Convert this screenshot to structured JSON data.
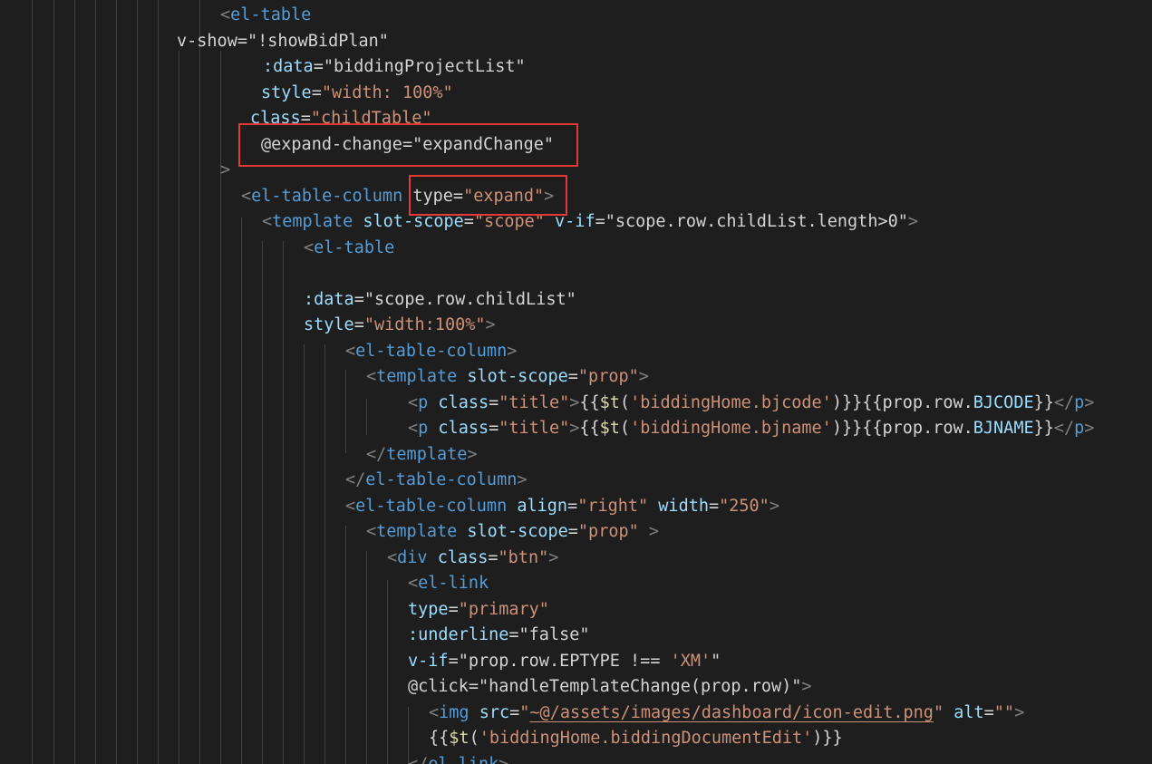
{
  "colors": {
    "background": "#1e1e1e",
    "indent_guide": "#404040",
    "punctuation": "#808080",
    "tag": "#569cd6",
    "attribute": "#9cdcfe",
    "string": "#ce9178",
    "plain": "#d4d4d4",
    "function": "#dcdcaa",
    "highlight_border": "#e53935"
  },
  "lines": [
    {
      "indent": 243,
      "tokens": [
        {
          "t": "<",
          "c": "punct"
        },
        {
          "t": "el-table",
          "c": "tag"
        }
      ]
    },
    {
      "indent": 195,
      "tokens": [
        {
          "t": "v-show=",
          "c": "plain"
        },
        {
          "t": "\"!showBidPlan\"",
          "c": "plain"
        }
      ]
    },
    {
      "indent": 290,
      "tokens": [
        {
          "t": ":data",
          "c": "attr"
        },
        {
          "t": "=",
          "c": "plain"
        },
        {
          "t": "\"biddingProjectList\"",
          "c": "plain"
        }
      ]
    },
    {
      "indent": 288,
      "tokens": [
        {
          "t": "style",
          "c": "attr"
        },
        {
          "t": "=",
          "c": "plain"
        },
        {
          "t": "\"width: 100%\"",
          "c": "str"
        }
      ]
    },
    {
      "indent": 276,
      "tokens": [
        {
          "t": "class",
          "c": "attr"
        },
        {
          "t": "=",
          "c": "plain"
        },
        {
          "t": "\"childTable\"",
          "c": "str"
        }
      ]
    },
    {
      "indent": 288,
      "tokens": [
        {
          "t": "@expand-change",
          "c": "plain"
        },
        {
          "t": "=",
          "c": "plain"
        },
        {
          "t": "\"expandChange\"",
          "c": "plain"
        }
      ]
    },
    {
      "indent": 243,
      "tokens": [
        {
          "t": ">",
          "c": "punct"
        }
      ]
    },
    {
      "indent": 266,
      "tokens": [
        {
          "t": "<",
          "c": "punct"
        },
        {
          "t": "el-table-column",
          "c": "tag"
        },
        {
          "t": " ",
          "c": "plain"
        },
        {
          "t": "type",
          "c": "plain"
        },
        {
          "t": "=",
          "c": "plain"
        },
        {
          "t": "\"expand\"",
          "c": "str"
        },
        {
          "t": ">",
          "c": "punct"
        }
      ]
    },
    {
      "indent": 289,
      "tokens": [
        {
          "t": "<",
          "c": "punct"
        },
        {
          "t": "template",
          "c": "tag"
        },
        {
          "t": " slot-scope",
          "c": "attr"
        },
        {
          "t": "=",
          "c": "plain"
        },
        {
          "t": "\"scope\"",
          "c": "str"
        },
        {
          "t": " v-if",
          "c": "attr"
        },
        {
          "t": "=",
          "c": "plain"
        },
        {
          "t": "\"scope.row.childList.length>0\"",
          "c": "plain"
        },
        {
          "t": ">",
          "c": "punct"
        }
      ]
    },
    {
      "indent": 335,
      "tokens": [
        {
          "t": "<",
          "c": "punct"
        },
        {
          "t": "el-table",
          "c": "tag"
        }
      ]
    },
    {
      "indent": 335,
      "tokens": []
    },
    {
      "indent": 335,
      "tokens": [
        {
          "t": ":data",
          "c": "attr"
        },
        {
          "t": "=",
          "c": "plain"
        },
        {
          "t": "\"scope.row.childList\"",
          "c": "plain"
        }
      ]
    },
    {
      "indent": 335,
      "tokens": [
        {
          "t": "style",
          "c": "attr"
        },
        {
          "t": "=",
          "c": "plain"
        },
        {
          "t": "\"width:100%\"",
          "c": "str"
        },
        {
          "t": ">",
          "c": "punct"
        }
      ]
    },
    {
      "indent": 381,
      "tokens": [
        {
          "t": "<",
          "c": "punct"
        },
        {
          "t": "el-table-column",
          "c": "tag"
        },
        {
          "t": ">",
          "c": "punct"
        }
      ]
    },
    {
      "indent": 404,
      "tokens": [
        {
          "t": "<",
          "c": "punct"
        },
        {
          "t": "template",
          "c": "tag"
        },
        {
          "t": " slot-scope",
          "c": "attr"
        },
        {
          "t": "=",
          "c": "plain"
        },
        {
          "t": "\"prop\"",
          "c": "str"
        },
        {
          "t": ">",
          "c": "punct"
        }
      ]
    },
    {
      "indent": 450,
      "tokens": [
        {
          "t": "<",
          "c": "punct"
        },
        {
          "t": "p",
          "c": "tag"
        },
        {
          "t": " class",
          "c": "attr"
        },
        {
          "t": "=",
          "c": "plain"
        },
        {
          "t": "\"title\"",
          "c": "str"
        },
        {
          "t": ">",
          "c": "punct"
        },
        {
          "t": "{{",
          "c": "plain"
        },
        {
          "t": "$t",
          "c": "fn"
        },
        {
          "t": "(",
          "c": "plain"
        },
        {
          "t": "'biddingHome.bjcode'",
          "c": "str"
        },
        {
          "t": ")}}{{prop.row.",
          "c": "plain"
        },
        {
          "t": "BJCODE",
          "c": "attr"
        },
        {
          "t": "}}",
          "c": "plain"
        },
        {
          "t": "</",
          "c": "punct"
        },
        {
          "t": "p",
          "c": "tag"
        },
        {
          "t": ">",
          "c": "punct"
        }
      ]
    },
    {
      "indent": 450,
      "tokens": [
        {
          "t": "<",
          "c": "punct"
        },
        {
          "t": "p",
          "c": "tag"
        },
        {
          "t": " class",
          "c": "attr"
        },
        {
          "t": "=",
          "c": "plain"
        },
        {
          "t": "\"title\"",
          "c": "str"
        },
        {
          "t": ">",
          "c": "punct"
        },
        {
          "t": "{{",
          "c": "plain"
        },
        {
          "t": "$t",
          "c": "fn"
        },
        {
          "t": "(",
          "c": "plain"
        },
        {
          "t": "'biddingHome.bjname'",
          "c": "str"
        },
        {
          "t": ")}}{{prop.row.",
          "c": "plain"
        },
        {
          "t": "BJNAME",
          "c": "attr"
        },
        {
          "t": "}}",
          "c": "plain"
        },
        {
          "t": "</",
          "c": "punct"
        },
        {
          "t": "p",
          "c": "tag"
        },
        {
          "t": ">",
          "c": "punct"
        }
      ]
    },
    {
      "indent": 404,
      "tokens": [
        {
          "t": "</",
          "c": "punct"
        },
        {
          "t": "template",
          "c": "tag"
        },
        {
          "t": ">",
          "c": "punct"
        }
      ]
    },
    {
      "indent": 381,
      "tokens": [
        {
          "t": "</",
          "c": "punct"
        },
        {
          "t": "el-table-column",
          "c": "tag"
        },
        {
          "t": ">",
          "c": "punct"
        }
      ]
    },
    {
      "indent": 381,
      "tokens": [
        {
          "t": "<",
          "c": "punct"
        },
        {
          "t": "el-table-column",
          "c": "tag"
        },
        {
          "t": " align",
          "c": "attr"
        },
        {
          "t": "=",
          "c": "plain"
        },
        {
          "t": "\"right\"",
          "c": "str"
        },
        {
          "t": " width",
          "c": "attr"
        },
        {
          "t": "=",
          "c": "plain"
        },
        {
          "t": "\"250\"",
          "c": "str"
        },
        {
          "t": ">",
          "c": "punct"
        }
      ]
    },
    {
      "indent": 404,
      "tokens": [
        {
          "t": "<",
          "c": "punct"
        },
        {
          "t": "template",
          "c": "tag"
        },
        {
          "t": " slot-scope",
          "c": "attr"
        },
        {
          "t": "=",
          "c": "plain"
        },
        {
          "t": "\"prop\"",
          "c": "str"
        },
        {
          "t": " >",
          "c": "punct"
        }
      ]
    },
    {
      "indent": 427,
      "tokens": [
        {
          "t": "<",
          "c": "punct"
        },
        {
          "t": "div",
          "c": "tag"
        },
        {
          "t": " class",
          "c": "attr"
        },
        {
          "t": "=",
          "c": "plain"
        },
        {
          "t": "\"btn\"",
          "c": "str"
        },
        {
          "t": ">",
          "c": "punct"
        }
      ]
    },
    {
      "indent": 450,
      "tokens": [
        {
          "t": "<",
          "c": "punct"
        },
        {
          "t": "el-link",
          "c": "tag"
        }
      ]
    },
    {
      "indent": 450,
      "tokens": [
        {
          "t": "type",
          "c": "attr"
        },
        {
          "t": "=",
          "c": "plain"
        },
        {
          "t": "\"primary\"",
          "c": "str"
        }
      ]
    },
    {
      "indent": 450,
      "tokens": [
        {
          "t": ":underline",
          "c": "attr"
        },
        {
          "t": "=",
          "c": "plain"
        },
        {
          "t": "\"false\"",
          "c": "plain"
        }
      ]
    },
    {
      "indent": 450,
      "tokens": [
        {
          "t": "v-if",
          "c": "attr"
        },
        {
          "t": "=",
          "c": "plain"
        },
        {
          "t": "\"prop.row.EPTYPE !== ",
          "c": "plain"
        },
        {
          "t": "'XM'",
          "c": "str"
        },
        {
          "t": "\"",
          "c": "plain"
        }
      ]
    },
    {
      "indent": 450,
      "tokens": [
        {
          "t": "@click",
          "c": "plain"
        },
        {
          "t": "=",
          "c": "plain"
        },
        {
          "t": "\"handleTemplateChange(prop.row)\"",
          "c": "plain"
        },
        {
          "t": ">",
          "c": "punct"
        }
      ]
    },
    {
      "indent": 473,
      "tokens": [
        {
          "t": "<",
          "c": "punct"
        },
        {
          "t": "img",
          "c": "tag"
        },
        {
          "t": " src",
          "c": "attr"
        },
        {
          "t": "=",
          "c": "plain"
        },
        {
          "t": "\"",
          "c": "str"
        },
        {
          "t": "~@/assets/images/dashboard/icon-edit.png",
          "c": "str ul"
        },
        {
          "t": "\"",
          "c": "str"
        },
        {
          "t": " alt",
          "c": "attr"
        },
        {
          "t": "=",
          "c": "plain"
        },
        {
          "t": "\"\"",
          "c": "str"
        },
        {
          "t": ">",
          "c": "punct"
        }
      ]
    },
    {
      "indent": 473,
      "tokens": [
        {
          "t": "{{",
          "c": "plain"
        },
        {
          "t": "$t",
          "c": "fn"
        },
        {
          "t": "(",
          "c": "plain"
        },
        {
          "t": "'biddingHome.biddingDocumentEdit'",
          "c": "str"
        },
        {
          "t": ")}}",
          "c": "plain"
        }
      ]
    },
    {
      "indent": 450,
      "tokens": [
        {
          "t": "</",
          "c": "punct"
        },
        {
          "t": "el-link",
          "c": "tag"
        },
        {
          "t": ">",
          "c": "punct"
        }
      ]
    }
  ]
}
